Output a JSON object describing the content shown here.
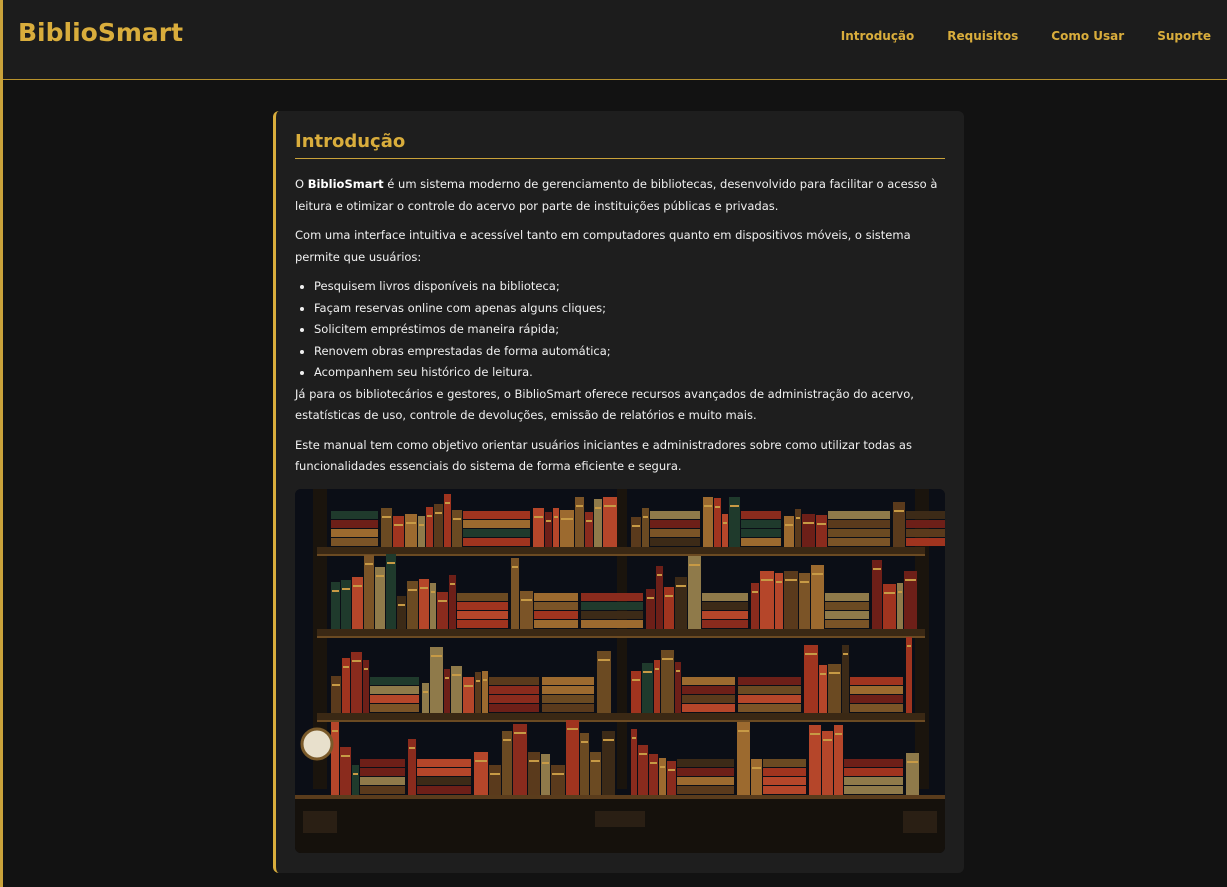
{
  "header": {
    "brand": "BiblioSmart",
    "nav": [
      {
        "label": "Introdução"
      },
      {
        "label": "Requisitos"
      },
      {
        "label": "Como Usar"
      },
      {
        "label": "Suporte"
      }
    ]
  },
  "intro": {
    "title": "Introdução",
    "p1_prefix": "O ",
    "p1_strong": "BiblioSmart",
    "p1_rest": " é um sistema moderno de gerenciamento de bibliotecas, desenvolvido para facilitar o acesso à leitura e otimizar o controle do acervo por parte de instituições públicas e privadas.",
    "p2": "Com uma interface intuitiva e acessível tanto em computadores quanto em dispositivos móveis, o sistema permite que usuários:",
    "features": [
      "Pesquisem livros disponíveis na biblioteca;",
      "Façam reservas online com apenas alguns cliques;",
      "Solicitem empréstimos de maneira rápida;",
      "Renovem obras emprestadas de forma automática;",
      "Acompanhem seu histórico de leitura."
    ],
    "p3": "Já para os bibliotecários e gestores, o BiblioSmart oferece recursos avançados de administração do acervo, estatísticas de uso, controle de devoluções, emissão de relatórios e muito mais.",
    "p4": "Este manual tem como objetivo orientar usuários iniciantes e administradores sobre como utilizar todas as funcionalidades essenciais do sistema de forma eficiente e segura."
  },
  "colors": {
    "accent": "#d9ad3c",
    "background": "#121212",
    "header_bg": "#1c1c1c",
    "card_bg": "#1e1e1e"
  },
  "image": {
    "icon": "bookshelf-illustration"
  }
}
